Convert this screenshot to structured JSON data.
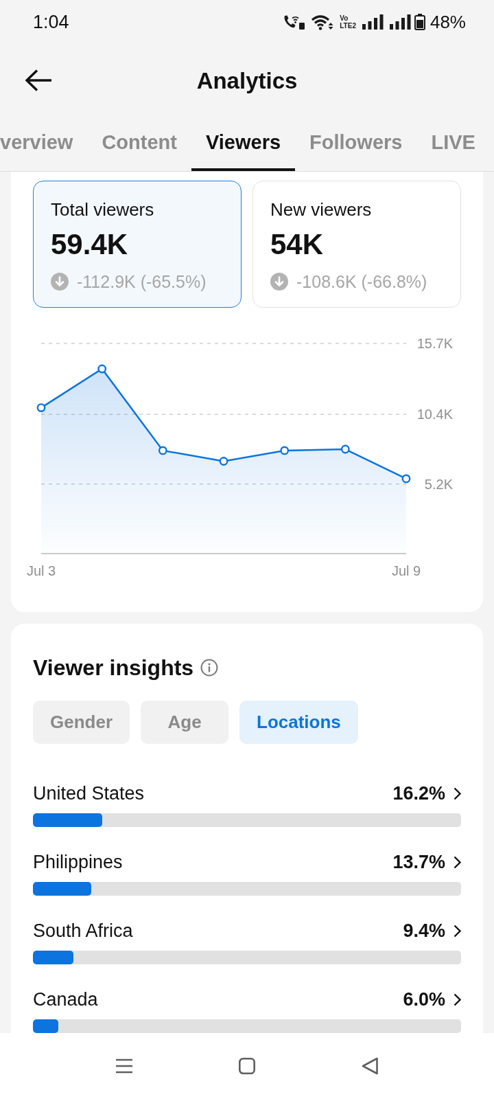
{
  "status_bar": {
    "time": "1:04",
    "network_label": {
      "top": "Vo",
      "bottom": "LTE2"
    },
    "battery": "48%"
  },
  "header": {
    "title": "Analytics"
  },
  "tabs": [
    {
      "label": "verview",
      "selected": false
    },
    {
      "label": "Content",
      "selected": false
    },
    {
      "label": "Viewers",
      "selected": true
    },
    {
      "label": "Followers",
      "selected": false
    },
    {
      "label": "LIVE",
      "selected": false
    }
  ],
  "metrics": [
    {
      "label": "Total viewers",
      "value": "59.4K",
      "decreased": true,
      "change": "-112.9K (-65.5%)",
      "selected": true
    },
    {
      "label": "New viewers",
      "value": "54K",
      "decreased": true,
      "change": "-108.6K (-66.8%)",
      "selected": false
    }
  ],
  "chart": {
    "chart_data": {
      "type": "area",
      "categories": [
        "Jul 3",
        null,
        null,
        null,
        null,
        null,
        "Jul 9"
      ],
      "ylim": [
        0,
        15700
      ],
      "yticks": [
        {
          "value": 5200,
          "label": "5.2K"
        },
        {
          "value": 10400,
          "label": "10.4K"
        },
        {
          "value": 15700,
          "label": "15.7K"
        }
      ],
      "series": [
        {
          "color": "#0b74de",
          "values": [
            10900,
            13800,
            7700,
            6900,
            7700,
            7800,
            5600
          ]
        }
      ]
    }
  },
  "viewer_insights": {
    "title": "Viewer insights",
    "filters": [
      {
        "label": "Gender",
        "selected": false
      },
      {
        "label": "Age",
        "selected": false
      },
      {
        "label": "Locations",
        "selected": true
      }
    ],
    "locations": [
      {
        "name": "United States",
        "percent": "16.2%",
        "level": 0.162
      },
      {
        "name": "Philippines",
        "percent": "13.7%",
        "level": 0.137
      },
      {
        "name": "South Africa",
        "percent": "9.4%",
        "level": 0.094
      },
      {
        "name": "Canada",
        "percent": "6.0%",
        "level": 0.06
      }
    ]
  }
}
